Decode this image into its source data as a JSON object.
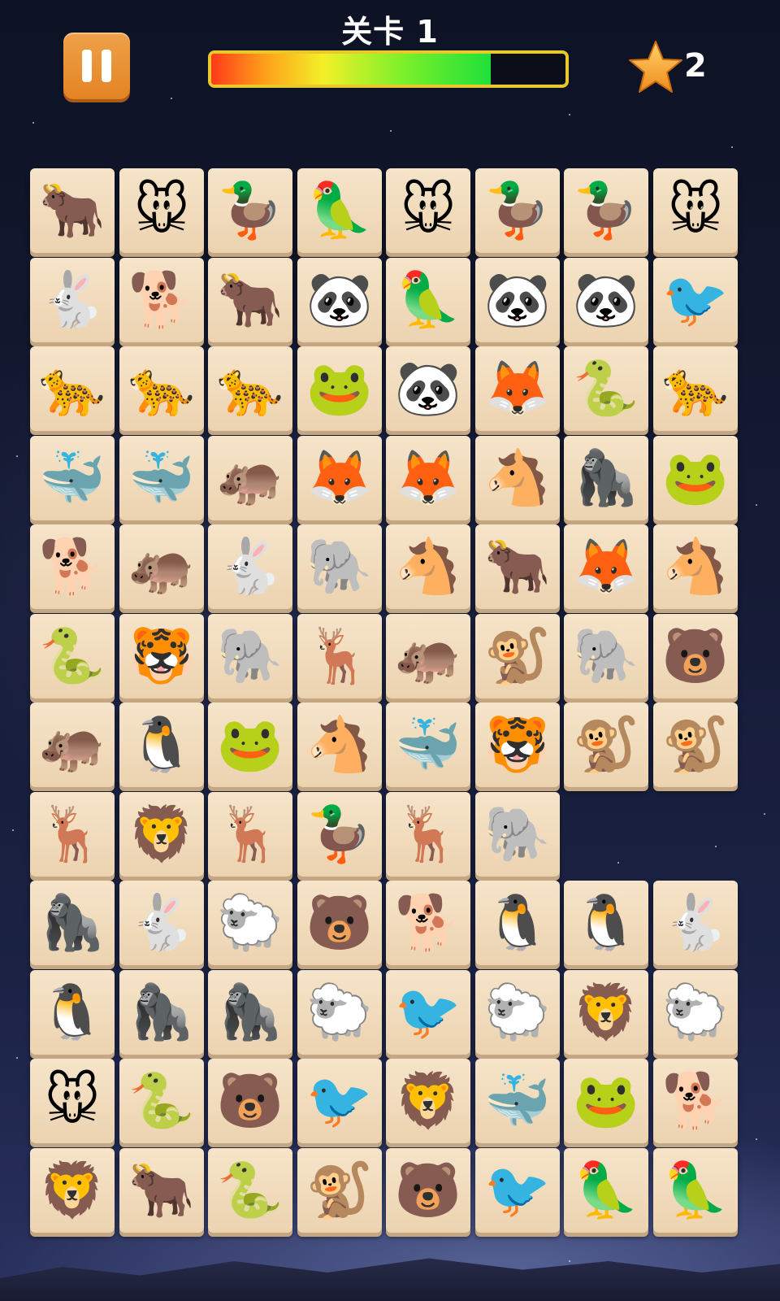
{
  "hud": {
    "level_label": "关卡 1",
    "progress_fraction": 0.79,
    "stars_count": "2",
    "pause_icon": "pause-icon",
    "star_icon": "star-icon",
    "accent_color": "#e88a2a"
  },
  "board": {
    "rows": [
      [
        "ox",
        "mouse",
        "duck",
        "parrot",
        "mouse",
        "duck",
        "duck",
        "mouse"
      ],
      [
        "rabbit",
        "dog",
        "ox",
        "panda",
        "parrot",
        "panda",
        "panda",
        "toucan"
      ],
      [
        "leopard",
        "leopard",
        "leopard",
        "frog",
        "panda",
        "fox",
        "snake",
        "leopard"
      ],
      [
        "whale",
        "whale",
        "hippo",
        "fox",
        "fox",
        "horse",
        "gorilla",
        "frog"
      ],
      [
        "dog",
        "hippo",
        "rabbit",
        "elephant",
        "horse",
        "ox",
        "fox",
        "horse"
      ],
      [
        "snake",
        "tiger",
        "elephant",
        "deer",
        "hippo",
        "monkey",
        "elephant",
        "bear"
      ],
      [
        "hippo",
        "penguin",
        "frog",
        "horse",
        "whale",
        "tiger",
        "monkey",
        "monkey"
      ],
      [
        "deer",
        "lion",
        "deer",
        "duck",
        "deer",
        "elephant",
        "",
        ""
      ],
      [
        "gorilla",
        "rabbit",
        "sheep",
        "bear",
        "dog",
        "penguin",
        "penguin",
        "rabbit"
      ],
      [
        "penguin",
        "gorilla",
        "gorilla",
        "sheep",
        "toucan",
        "sheep",
        "lion",
        "sheep"
      ],
      [
        "mouse",
        "snake",
        "bear",
        "toucan",
        "lion",
        "whale",
        "frog",
        "dog"
      ],
      [
        "lion",
        "ox",
        "snake",
        "monkey",
        "bear",
        "toucan",
        "parrot",
        "parrot"
      ]
    ]
  }
}
